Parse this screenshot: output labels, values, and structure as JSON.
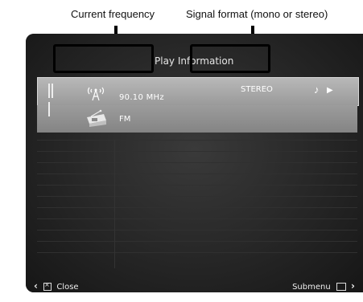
{
  "callouts": {
    "frequency": "Current frequency",
    "signal": "Signal format (mono or stereo)"
  },
  "screen": {
    "title": "Play Information",
    "frequency": "90.10  MHz",
    "signal_format": "STEREO",
    "band": "FM",
    "icons": {
      "grip": "grip-icon",
      "antenna": "antenna-icon",
      "note": "music-note-icon",
      "play": "play-icon",
      "radio": "radio-icon"
    },
    "bottom": {
      "close": "Close",
      "submenu": "Submenu"
    }
  }
}
